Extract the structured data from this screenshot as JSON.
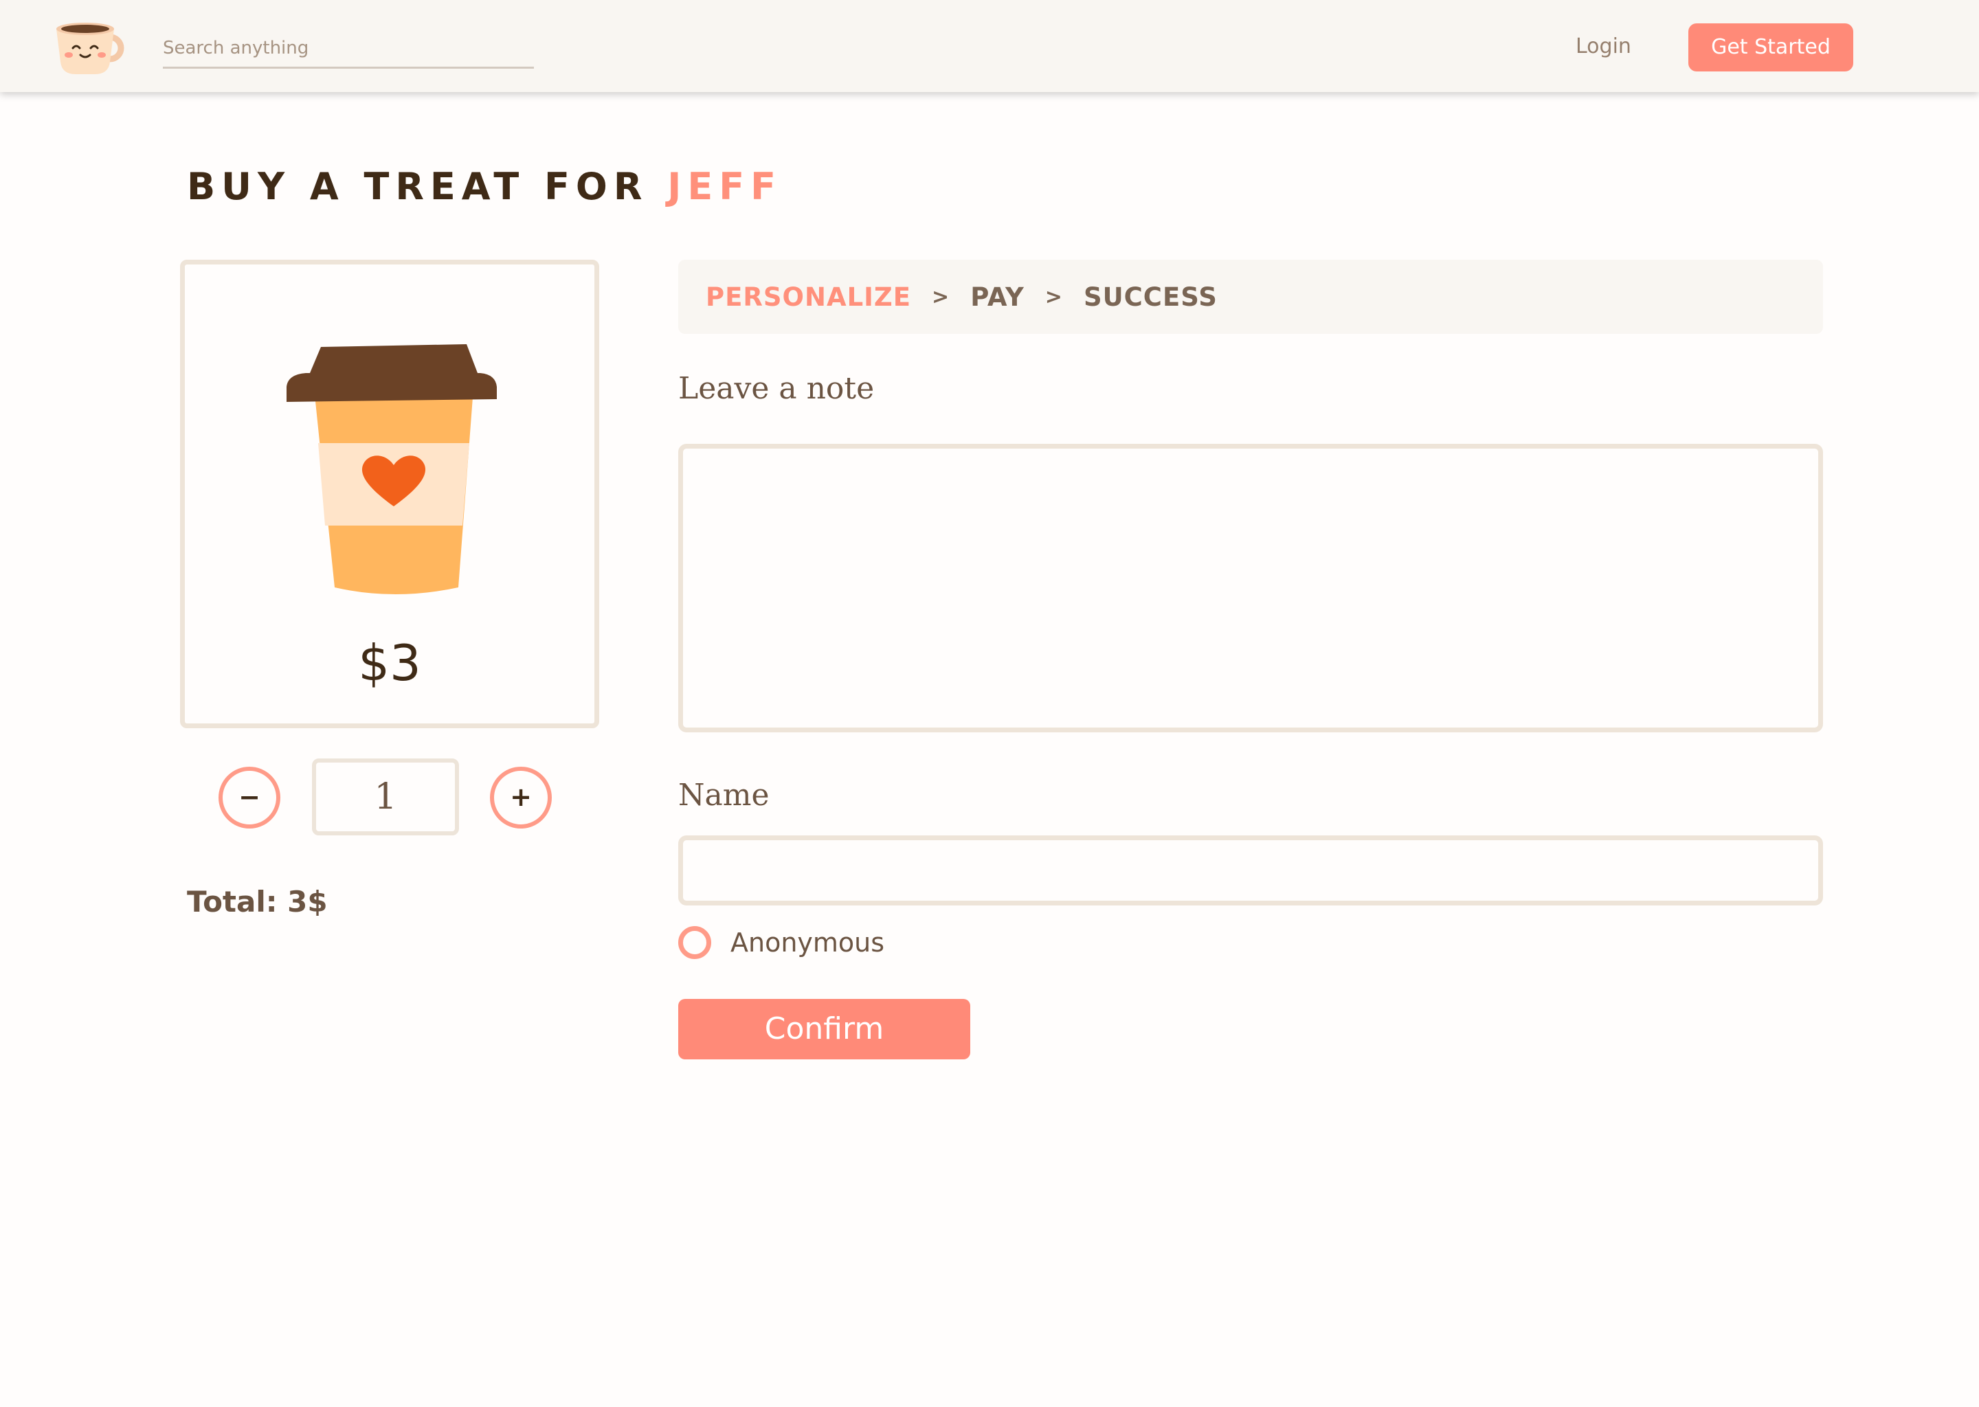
{
  "header": {
    "logo_name": "smiling-coffee-cup-logo",
    "search": {
      "placeholder": "Search anything",
      "value": ""
    },
    "login_label": "Login",
    "cta_label": "Get Started"
  },
  "page": {
    "title_prefix": "BUY A TREAT FOR",
    "recipient": "JEFF"
  },
  "product": {
    "icon": "coffee-cup-heart-icon",
    "price": "$3",
    "quantity": "1",
    "minus_label": "−",
    "plus_label": "+",
    "total": "Total: 3$"
  },
  "steps": {
    "items": [
      {
        "label": "PERSONALIZE",
        "active": true
      },
      {
        "label": "PAY",
        "active": false
      },
      {
        "label": "SUCCESS",
        "active": false
      }
    ],
    "separator": ">"
  },
  "form": {
    "note_label": "Leave a note",
    "note_value": "",
    "name_label": "Name",
    "name_value": "",
    "anonymous_label": "Anonymous",
    "confirm_label": "Confirm"
  },
  "colors": {
    "accent": "#ff8a78",
    "accent_text": "#ff907b",
    "dark_brown": "#3f2a16",
    "text_brown": "#6b5442",
    "border": "#eee4d8",
    "header_bg": "#f9f6f2"
  }
}
